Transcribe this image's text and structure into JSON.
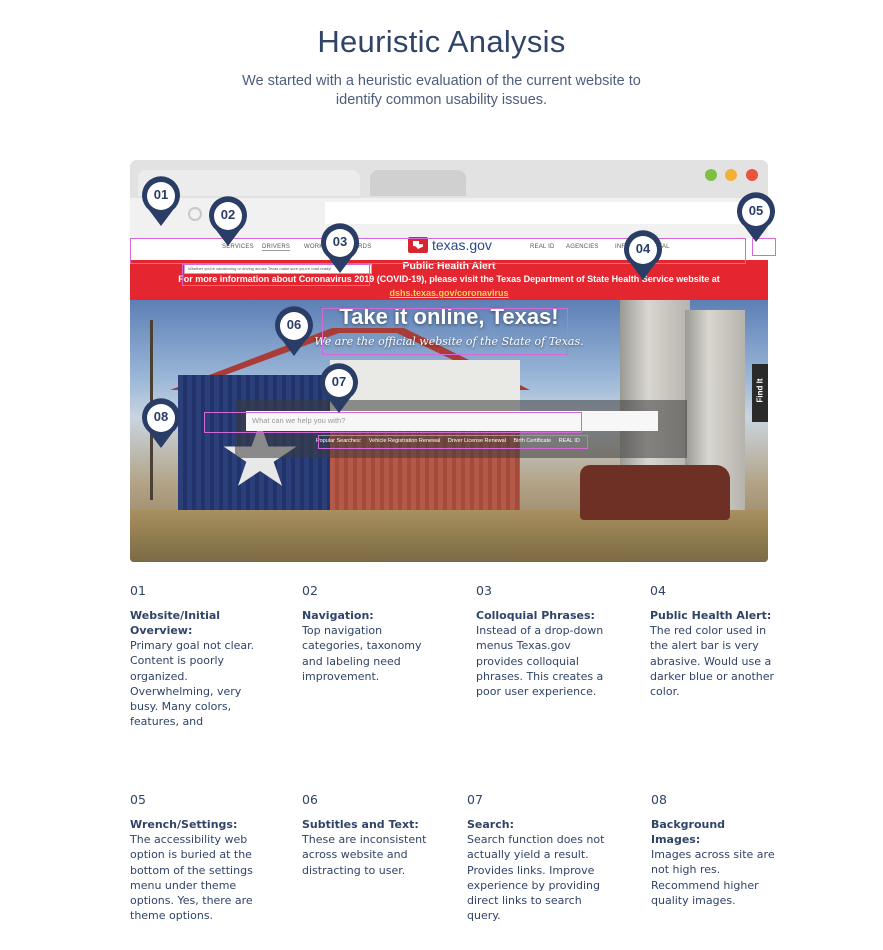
{
  "page": {
    "title": "Heuristic Analysis",
    "subtitle": "We started with a heuristic evaluation of the current website to identify common usability issues."
  },
  "site": {
    "logo_text": "texas.gov",
    "nav": [
      "SERVICES",
      "DRIVERS",
      "WORK",
      "RECORDS",
      "REAL ID",
      "AGENCIES",
      "INFO",
      "PORTAL"
    ],
    "tooltip": "Whether you're vacationing or driving across Texas make sure you're road ready!",
    "alert_title": "Public Health Alert",
    "alert_body": "For more information about Coronavirus 2019 (COVID-19), please visit the Texas Department of State Health Service website at",
    "alert_link": "dshs.texas.gov/coronavirus",
    "hero_title": "Take it online, Texas!",
    "hero_subtitle": "We are the official website of the State of Texas.",
    "search_placeholder": "What can we help you with?",
    "popular_label": "Popular Searches:",
    "popular": [
      "Vehicle Registration Renewal",
      "Driver License Renewal",
      "Birth Certificate",
      "REAL ID"
    ],
    "find_it": "Find It"
  },
  "markers": [
    "01",
    "02",
    "03",
    "04",
    "05",
    "06",
    "07",
    "08"
  ],
  "notes": [
    {
      "num": "01",
      "heading": "Website/Initial Overview:",
      "body": "Primary goal not clear. Content is poorly organized. Overwhelming, very busy. Many colors, features, and"
    },
    {
      "num": "02",
      "heading": "Navigation:",
      "body": "Top navigation categories, taxonomy and labeling need improvement."
    },
    {
      "num": "03",
      "heading": "Colloquial Phrases:",
      "body": "Instead of a drop-down menus Texas.gov provides colloquial phrases. This creates a poor user experience."
    },
    {
      "num": "04",
      "heading": "Public Health Alert:",
      "body": "The red color used in the alert bar is very abrasive. Would use a darker blue or another color."
    },
    {
      "num": "05",
      "heading": "Wrench/Settings:",
      "body": "The accessibility web option is buried at the bottom of the settings menu under theme options. Yes, there are theme options."
    },
    {
      "num": "06",
      "heading": "Subtitles and Text:",
      "body": "These are inconsistent across website and distracting to user."
    },
    {
      "num": "07",
      "heading": "Search:",
      "body": "Search function does not actually yield a result. Provides links. Improve experience by providing direct links to search query."
    },
    {
      "num": "08",
      "heading": "Background Images:",
      "body": "Images across site are not high res. Recommend higher quality images."
    }
  ],
  "colors": {
    "navy": "#2f4468",
    "alert_red": "#e3262f",
    "highlight": "#d46ad8"
  }
}
